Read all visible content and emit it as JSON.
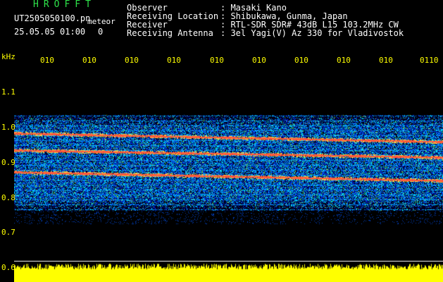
{
  "app": {
    "title": "HROFFT"
  },
  "file_info": {
    "filename": "UT2505050100.pn",
    "label": "meteor",
    "datetime": "25.05.05 01:00",
    "extra": "0"
  },
  "station": {
    "observer_label": "Observer",
    "observer_value": ": Masaki Kano",
    "location_label": "Receiving Location",
    "location_value": ": Shibukawa, Gunma, Japan",
    "receiver_label": "Receiver",
    "receiver_value": ": RTL-SDR SDR# 43dB L15 103.2MHz CW",
    "antenna_label": "Receiving Antenna",
    "antenna_value": ": 3el Yagi(V) Az 330 for Vladivostok"
  },
  "axis": {
    "unit": "kHz",
    "freq_ticks": [
      "1.1",
      "1.0",
      "0.9",
      "0.8",
      "0.7",
      "0.6"
    ],
    "time_ticks": [
      "010",
      "010",
      "010",
      "010",
      "010",
      "010",
      "010",
      "010",
      "010",
      "0110"
    ]
  },
  "colors": {
    "title": "#2ee34a",
    "axis": "#ffff00",
    "text": "#ffffff",
    "band_blue": "#1030d0",
    "trace_red": "#ff3030"
  }
}
